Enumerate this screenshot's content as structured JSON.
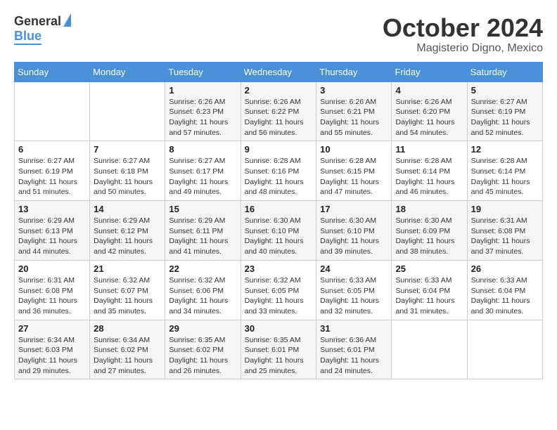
{
  "header": {
    "logo_general": "General",
    "logo_blue": "Blue",
    "month_title": "October 2024",
    "location": "Magisterio Digno, Mexico"
  },
  "weekdays": [
    "Sunday",
    "Monday",
    "Tuesday",
    "Wednesday",
    "Thursday",
    "Friday",
    "Saturday"
  ],
  "weeks": [
    [
      {
        "day": "",
        "sunrise": "",
        "sunset": "",
        "daylight": ""
      },
      {
        "day": "",
        "sunrise": "",
        "sunset": "",
        "daylight": ""
      },
      {
        "day": "1",
        "sunrise": "Sunrise: 6:26 AM",
        "sunset": "Sunset: 6:23 PM",
        "daylight": "Daylight: 11 hours and 57 minutes."
      },
      {
        "day": "2",
        "sunrise": "Sunrise: 6:26 AM",
        "sunset": "Sunset: 6:22 PM",
        "daylight": "Daylight: 11 hours and 56 minutes."
      },
      {
        "day": "3",
        "sunrise": "Sunrise: 6:26 AM",
        "sunset": "Sunset: 6:21 PM",
        "daylight": "Daylight: 11 hours and 55 minutes."
      },
      {
        "day": "4",
        "sunrise": "Sunrise: 6:26 AM",
        "sunset": "Sunset: 6:20 PM",
        "daylight": "Daylight: 11 hours and 54 minutes."
      },
      {
        "day": "5",
        "sunrise": "Sunrise: 6:27 AM",
        "sunset": "Sunset: 6:19 PM",
        "daylight": "Daylight: 11 hours and 52 minutes."
      }
    ],
    [
      {
        "day": "6",
        "sunrise": "Sunrise: 6:27 AM",
        "sunset": "Sunset: 6:19 PM",
        "daylight": "Daylight: 11 hours and 51 minutes."
      },
      {
        "day": "7",
        "sunrise": "Sunrise: 6:27 AM",
        "sunset": "Sunset: 6:18 PM",
        "daylight": "Daylight: 11 hours and 50 minutes."
      },
      {
        "day": "8",
        "sunrise": "Sunrise: 6:27 AM",
        "sunset": "Sunset: 6:17 PM",
        "daylight": "Daylight: 11 hours and 49 minutes."
      },
      {
        "day": "9",
        "sunrise": "Sunrise: 6:28 AM",
        "sunset": "Sunset: 6:16 PM",
        "daylight": "Daylight: 11 hours and 48 minutes."
      },
      {
        "day": "10",
        "sunrise": "Sunrise: 6:28 AM",
        "sunset": "Sunset: 6:15 PM",
        "daylight": "Daylight: 11 hours and 47 minutes."
      },
      {
        "day": "11",
        "sunrise": "Sunrise: 6:28 AM",
        "sunset": "Sunset: 6:14 PM",
        "daylight": "Daylight: 11 hours and 46 minutes."
      },
      {
        "day": "12",
        "sunrise": "Sunrise: 6:28 AM",
        "sunset": "Sunset: 6:14 PM",
        "daylight": "Daylight: 11 hours and 45 minutes."
      }
    ],
    [
      {
        "day": "13",
        "sunrise": "Sunrise: 6:29 AM",
        "sunset": "Sunset: 6:13 PM",
        "daylight": "Daylight: 11 hours and 44 minutes."
      },
      {
        "day": "14",
        "sunrise": "Sunrise: 6:29 AM",
        "sunset": "Sunset: 6:12 PM",
        "daylight": "Daylight: 11 hours and 42 minutes."
      },
      {
        "day": "15",
        "sunrise": "Sunrise: 6:29 AM",
        "sunset": "Sunset: 6:11 PM",
        "daylight": "Daylight: 11 hours and 41 minutes."
      },
      {
        "day": "16",
        "sunrise": "Sunrise: 6:30 AM",
        "sunset": "Sunset: 6:10 PM",
        "daylight": "Daylight: 11 hours and 40 minutes."
      },
      {
        "day": "17",
        "sunrise": "Sunrise: 6:30 AM",
        "sunset": "Sunset: 6:10 PM",
        "daylight": "Daylight: 11 hours and 39 minutes."
      },
      {
        "day": "18",
        "sunrise": "Sunrise: 6:30 AM",
        "sunset": "Sunset: 6:09 PM",
        "daylight": "Daylight: 11 hours and 38 minutes."
      },
      {
        "day": "19",
        "sunrise": "Sunrise: 6:31 AM",
        "sunset": "Sunset: 6:08 PM",
        "daylight": "Daylight: 11 hours and 37 minutes."
      }
    ],
    [
      {
        "day": "20",
        "sunrise": "Sunrise: 6:31 AM",
        "sunset": "Sunset: 6:08 PM",
        "daylight": "Daylight: 11 hours and 36 minutes."
      },
      {
        "day": "21",
        "sunrise": "Sunrise: 6:32 AM",
        "sunset": "Sunset: 6:07 PM",
        "daylight": "Daylight: 11 hours and 35 minutes."
      },
      {
        "day": "22",
        "sunrise": "Sunrise: 6:32 AM",
        "sunset": "Sunset: 6:06 PM",
        "daylight": "Daylight: 11 hours and 34 minutes."
      },
      {
        "day": "23",
        "sunrise": "Sunrise: 6:32 AM",
        "sunset": "Sunset: 6:05 PM",
        "daylight": "Daylight: 11 hours and 33 minutes."
      },
      {
        "day": "24",
        "sunrise": "Sunrise: 6:33 AM",
        "sunset": "Sunset: 6:05 PM",
        "daylight": "Daylight: 11 hours and 32 minutes."
      },
      {
        "day": "25",
        "sunrise": "Sunrise: 6:33 AM",
        "sunset": "Sunset: 6:04 PM",
        "daylight": "Daylight: 11 hours and 31 minutes."
      },
      {
        "day": "26",
        "sunrise": "Sunrise: 6:33 AM",
        "sunset": "Sunset: 6:04 PM",
        "daylight": "Daylight: 11 hours and 30 minutes."
      }
    ],
    [
      {
        "day": "27",
        "sunrise": "Sunrise: 6:34 AM",
        "sunset": "Sunset: 6:03 PM",
        "daylight": "Daylight: 11 hours and 29 minutes."
      },
      {
        "day": "28",
        "sunrise": "Sunrise: 6:34 AM",
        "sunset": "Sunset: 6:02 PM",
        "daylight": "Daylight: 11 hours and 27 minutes."
      },
      {
        "day": "29",
        "sunrise": "Sunrise: 6:35 AM",
        "sunset": "Sunset: 6:02 PM",
        "daylight": "Daylight: 11 hours and 26 minutes."
      },
      {
        "day": "30",
        "sunrise": "Sunrise: 6:35 AM",
        "sunset": "Sunset: 6:01 PM",
        "daylight": "Daylight: 11 hours and 25 minutes."
      },
      {
        "day": "31",
        "sunrise": "Sunrise: 6:36 AM",
        "sunset": "Sunset: 6:01 PM",
        "daylight": "Daylight: 11 hours and 24 minutes."
      },
      {
        "day": "",
        "sunrise": "",
        "sunset": "",
        "daylight": ""
      },
      {
        "day": "",
        "sunrise": "",
        "sunset": "",
        "daylight": ""
      }
    ]
  ]
}
